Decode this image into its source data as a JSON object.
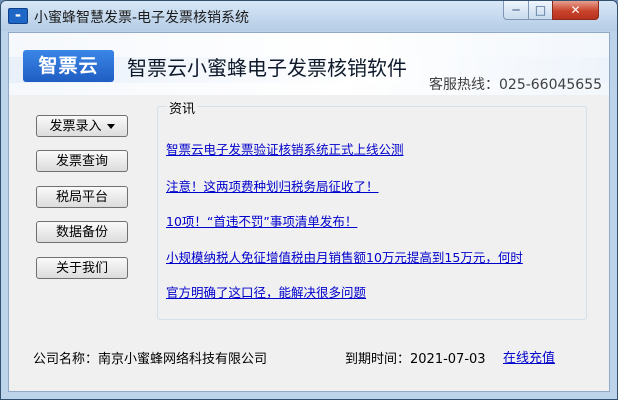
{
  "window": {
    "title": "小蜜蜂智慧发票-电子发票核销系统",
    "icon_name": "app-icon",
    "controls": {
      "minimize": "─",
      "maximize": "□",
      "close": "✕"
    }
  },
  "banner": {
    "logo_text": "智票云",
    "title": "智票云小蜜蜂电子发票核销软件",
    "hotline": "客服热线：025-66045655"
  },
  "sidebar": {
    "buttons": [
      {
        "label": "发票录入"
      },
      {
        "label": "发票查询"
      },
      {
        "label": "税局平台"
      },
      {
        "label": "数据备份"
      },
      {
        "label": "关于我们"
      }
    ]
  },
  "news": {
    "heading": "资讯",
    "items": [
      "智票云电子发票验证核销系统正式上线公测",
      "注意！这两项费种划归税务局征收了！",
      "10项！“首违不罚”事项清单发布！",
      "小规模纳税人免征增值税由月销售额10万元提高到15万元，何时",
      "官方明确了这口径，能解决很多问题"
    ]
  },
  "footer": {
    "company": "公司名称：南京小蜜蜂网络科技有限公司",
    "expiry": "到期时间：2021-07-03",
    "renew_link": "在线充值"
  },
  "colors": {
    "link": "#0000cc",
    "titlebar": "#c6dbef",
    "logo": "#2a6fd6",
    "close": "#c9432c"
  }
}
